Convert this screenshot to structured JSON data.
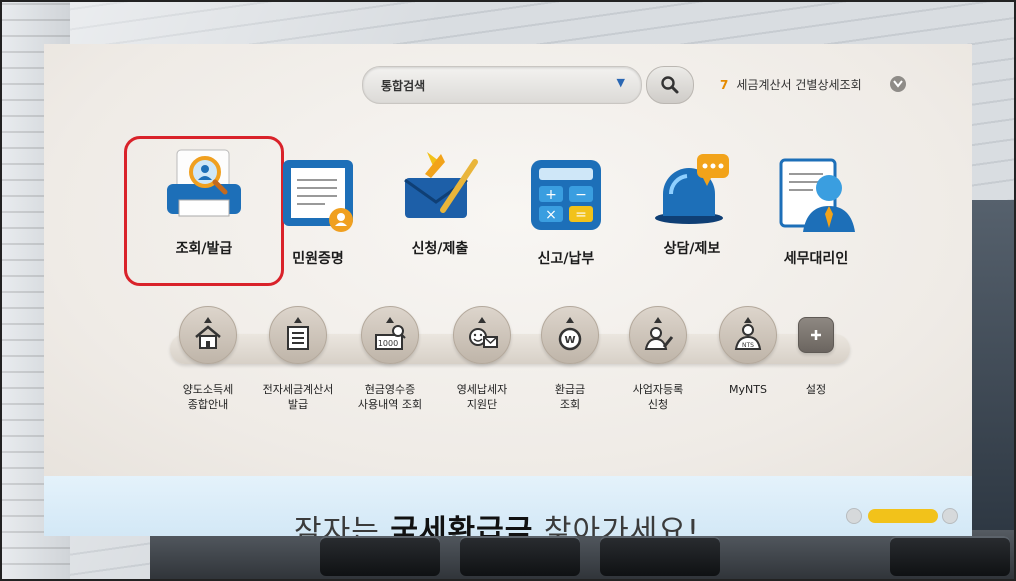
{
  "search": {
    "category_label": "통합검색"
  },
  "popular": {
    "rank": "7",
    "text": "세금계산서 건별상세조회"
  },
  "main_menu": [
    {
      "id": "inquiry",
      "label": "조회/발급",
      "icon": "document-search-icon"
    },
    {
      "id": "certificate",
      "label": "민원증명",
      "icon": "certificate-icon"
    },
    {
      "id": "apply",
      "label": "신청/제출",
      "icon": "envelope-pencil-icon"
    },
    {
      "id": "report",
      "label": "신고/납부",
      "icon": "calculator-icon"
    },
    {
      "id": "consult",
      "label": "상담/제보",
      "icon": "chat-siren-icon"
    },
    {
      "id": "agent",
      "label": "세무대리인",
      "icon": "agent-person-icon"
    }
  ],
  "quick_menu": [
    {
      "id": "transfer",
      "line1": "양도소득세",
      "line2": "종합안내",
      "icon": "house-icon"
    },
    {
      "id": "einvoice",
      "line1": "전자세금계산서",
      "line2": "발급",
      "icon": "invoice-icon"
    },
    {
      "id": "cashreceipt",
      "line1": "현금영수증",
      "line2": "사용내역 조회",
      "icon": "receipt-search-icon"
    },
    {
      "id": "smallbiz",
      "line1": "영세납세자",
      "line2": "지원단",
      "icon": "support-icon"
    },
    {
      "id": "refund",
      "line1": "환급금",
      "line2": "조회",
      "icon": "won-coin-icon"
    },
    {
      "id": "bizreg",
      "line1": "사업자등록",
      "line2": "신청",
      "icon": "person-register-icon"
    },
    {
      "id": "mynts",
      "line1": "MyNTS",
      "line2": "",
      "icon": "nts-person-icon"
    },
    {
      "id": "settings",
      "line1": "설정",
      "line2": "",
      "icon": "plus-icon"
    }
  ],
  "banner": {
    "pre": "잠자는 ",
    "bold": "국세환급금",
    "post": " 찾아가세요!"
  },
  "colors": {
    "highlight": "#d9222a",
    "accent": "#f2c21a",
    "rank": "#e58a00"
  }
}
